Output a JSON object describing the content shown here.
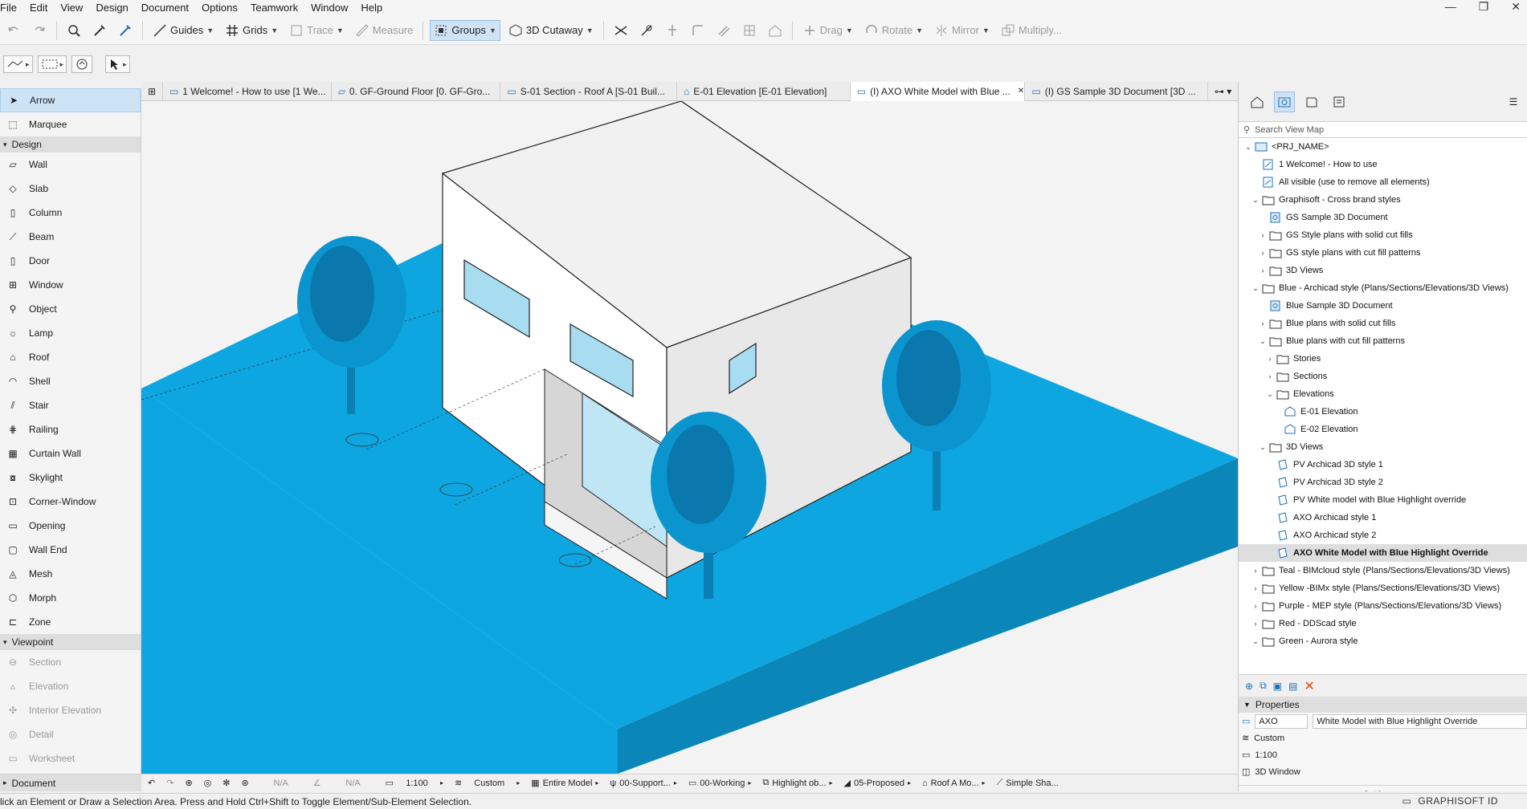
{
  "menu": [
    "File",
    "Edit",
    "View",
    "Design",
    "Document",
    "Options",
    "Teamwork",
    "Window",
    "Help"
  ],
  "toolbar": {
    "guides": "Guides",
    "grids": "Grids",
    "trace": "Trace",
    "measure": "Measure",
    "groups": "Groups",
    "cutaway": "3D Cutaway",
    "drag": "Drag",
    "rotate": "Rotate",
    "mirror": "Mirror",
    "multiply": "Multiply..."
  },
  "toolbox": {
    "arrow": "Arrow",
    "marquee": "Marquee",
    "design_header": "Design",
    "design_tools": [
      "Wall",
      "Slab",
      "Column",
      "Beam",
      "Door",
      "Window",
      "Object",
      "Lamp",
      "Roof",
      "Shell",
      "Stair",
      "Railing",
      "Curtain Wall",
      "Skylight",
      "Corner-Window",
      "Opening",
      "Wall End",
      "Mesh",
      "Morph",
      "Zone"
    ],
    "viewpoint_header": "Viewpoint",
    "viewpoint_tools": [
      "Section",
      "Elevation",
      "Interior Elevation",
      "Detail",
      "Worksheet"
    ],
    "document_header": "Document"
  },
  "tabs": [
    "1 Welcome! - How to use [1 We...",
    "0. GF-Ground Floor [0. GF-Gro...",
    "S-01 Section - Roof A [S-01 Buil...",
    "E-01 Elevation [E-01 Elevation]",
    "(I) AXO White Model with Blue ...",
    "(I) GS Sample 3D Document [3D ..."
  ],
  "statusbar": {
    "na1": "N/A",
    "na2": "N/A",
    "scale": "1:100",
    "custom": "Custom",
    "model": "Entire Model",
    "support": "00-Support...",
    "working": "00-Working",
    "highlight": "Highlight ob...",
    "proposed": "05-Proposed",
    "roof": "Roof A Mo...",
    "simple": "Simple Sha..."
  },
  "hint": "lick an Element or Draw a Selection Area. Press and Hold Ctrl+Shift to Toggle Element/Sub-Element Selection.",
  "brand": "GRAPHISOFT ID",
  "viewmap": {
    "search_placeholder": "Search View Map",
    "tree": [
      {
        "label": "<PRJ_NAME>",
        "level": 0,
        "exp": "v",
        "icon": "project"
      },
      {
        "label": "1 Welcome! - How to use",
        "level": 1,
        "exp": "",
        "icon": "view"
      },
      {
        "label": "All visible (use to remove all elements)",
        "level": 1,
        "exp": "",
        "icon": "view"
      },
      {
        "label": "Graphisoft - Cross brand styles",
        "level": 1,
        "exp": "v",
        "icon": "folder"
      },
      {
        "label": "GS Sample 3D Document",
        "level": 2,
        "exp": "",
        "icon": "doc3d"
      },
      {
        "label": "GS Style plans with solid cut fills",
        "level": 2,
        "exp": ">",
        "icon": "folder"
      },
      {
        "label": "GS style plans with cut fill patterns",
        "level": 2,
        "exp": ">",
        "icon": "folder"
      },
      {
        "label": "3D Views",
        "level": 2,
        "exp": ">",
        "icon": "folder"
      },
      {
        "label": "Blue - Archicad style (Plans/Sections/Elevations/3D Views)",
        "level": 1,
        "exp": "v",
        "icon": "folder"
      },
      {
        "label": "Blue Sample 3D Document",
        "level": 2,
        "exp": "",
        "icon": "doc3d"
      },
      {
        "label": "Blue plans with solid cut fills",
        "level": 2,
        "exp": ">",
        "icon": "folder"
      },
      {
        "label": "Blue plans with cut fill patterns",
        "level": 2,
        "exp": "v",
        "icon": "folder"
      },
      {
        "label": "Stories",
        "level": 3,
        "exp": ">",
        "icon": "folder"
      },
      {
        "label": "Sections",
        "level": 3,
        "exp": ">",
        "icon": "folder"
      },
      {
        "label": "Elevations",
        "level": 3,
        "exp": "v",
        "icon": "folder"
      },
      {
        "label": "E-01 Elevation",
        "level": 4,
        "exp": "",
        "icon": "elev"
      },
      {
        "label": "E-02 Elevation",
        "level": 4,
        "exp": "",
        "icon": "elev"
      },
      {
        "label": "3D Views",
        "level": 2,
        "exp": "v",
        "icon": "folder"
      },
      {
        "label": "PV Archicad 3D style 1",
        "level": 3,
        "exp": "",
        "icon": "view3d"
      },
      {
        "label": "PV Archicad 3D style 2",
        "level": 3,
        "exp": "",
        "icon": "view3d"
      },
      {
        "label": "PV White model with Blue Highlight override",
        "level": 3,
        "exp": "",
        "icon": "view3d"
      },
      {
        "label": "AXO Archicad style 1",
        "level": 3,
        "exp": "",
        "icon": "view3d"
      },
      {
        "label": "AXO Archicad style 2",
        "level": 3,
        "exp": "",
        "icon": "view3d"
      },
      {
        "label": "AXO White Model with Blue Highlight Override",
        "level": 3,
        "exp": "",
        "icon": "view3d",
        "selected": true
      },
      {
        "label": "Teal - BIMcloud style (Plans/Sections/Elevations/3D Views)",
        "level": 1,
        "exp": ">",
        "icon": "folder"
      },
      {
        "label": "Yellow -BIMx style (Plans/Sections/Elevations/3D Views)",
        "level": 1,
        "exp": ">",
        "icon": "folder"
      },
      {
        "label": "Purple - MEP style (Plans/Sections/Elevations/3D Views)",
        "level": 1,
        "exp": ">",
        "icon": "folder"
      },
      {
        "label": "Red - DDScad style",
        "level": 1,
        "exp": ">",
        "icon": "folder"
      },
      {
        "label": "Green - Aurora style",
        "level": 1,
        "exp": "v",
        "icon": "folder"
      }
    ]
  },
  "properties": {
    "header": "Properties",
    "id": "AXO",
    "name": "White Model with Blue Highlight Override",
    "custom": "Custom",
    "scale": "1:100",
    "window": "3D Window",
    "settings": "Settings..."
  },
  "colors": {
    "accent_blue": "#0da6e0",
    "dark_blue": "#0a86b8",
    "selection": "#cde4f7"
  }
}
